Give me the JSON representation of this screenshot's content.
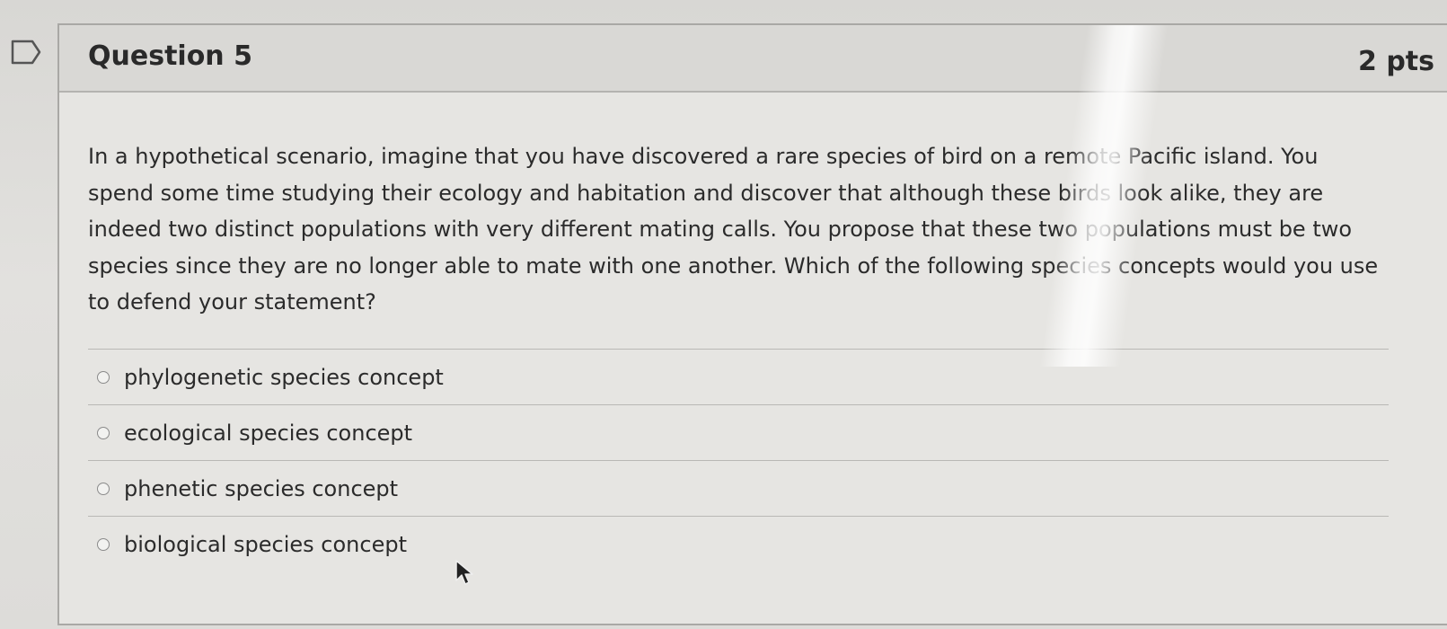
{
  "question": {
    "title": "Question 5",
    "points": "2 pts",
    "stem": "In a hypothetical scenario, imagine that you have discovered a rare species of bird on a remote Pacific island. You spend some time studying their ecology and habitation and discover that although these birds look alike, they are indeed two distinct populations with very different mating calls. You propose that these two populations must be two species since they are no longer able to mate with one another. Which of the following species concepts would you use to defend your statement?",
    "answers": [
      {
        "label": "phylogenetic species concept"
      },
      {
        "label": "ecological species concept"
      },
      {
        "label": "phenetic species concept"
      },
      {
        "label": "biological species concept"
      }
    ]
  },
  "icons": {
    "bookmark": "bookmark-flag-icon",
    "cursor": "mouse-pointer-icon",
    "radio": "radio-button-icon"
  },
  "colors": {
    "border": "#a9a8a5",
    "header_bg": "#d9d8d5",
    "text": "#2b2b2b"
  }
}
